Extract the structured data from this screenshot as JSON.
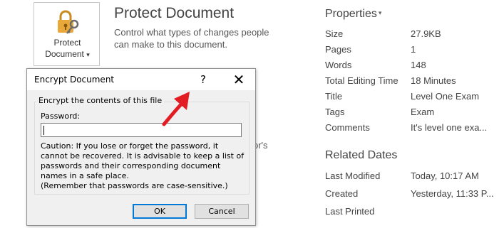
{
  "protect": {
    "tile_line1": "Protect",
    "tile_line2": "Document",
    "tile_caret": "▾",
    "title": "Protect Document",
    "description": "Control what types of changes people can make to this document.",
    "partial_bg_text": "or's"
  },
  "properties": {
    "heading": "Properties",
    "heading_caret": "▾",
    "rows": [
      {
        "label": "Size",
        "value": "27.9KB"
      },
      {
        "label": "Pages",
        "value": "1"
      },
      {
        "label": "Words",
        "value": "148"
      },
      {
        "label": "Total Editing Time",
        "value": "18 Minutes"
      },
      {
        "label": "Title",
        "value": "Level One Exam"
      },
      {
        "label": "Tags",
        "value": "Exam"
      },
      {
        "label": "Comments",
        "value": "It's level one exa..."
      }
    ]
  },
  "related_dates": {
    "heading": "Related Dates",
    "rows": [
      {
        "label": "Last Modified",
        "value": "Today, 10:17 AM"
      },
      {
        "label": "Created",
        "value": "Yesterday, 11:33 P..."
      },
      {
        "label": "Last Printed",
        "value": ""
      }
    ]
  },
  "dialog": {
    "title": "Encrypt Document",
    "help": "?",
    "close": "✕",
    "group_label": "Encrypt the contents of this file",
    "password_label": "Password:",
    "password_value": "",
    "caution_lines": [
      "Caution: If you lose or forget the password, it",
      "cannot be recovered. It is advisable to keep a list of",
      "passwords and their corresponding document",
      "names in a safe place.",
      "(Remember that passwords are case-sensitive.)"
    ],
    "ok_label": "OK",
    "cancel_label": "Cancel"
  },
  "colors": {
    "lock_gold": "#e8a93a",
    "key_gray": "#6b6b6b",
    "annotation_red": "#e31b23",
    "ok_border": "#0078d7"
  },
  "icons": {
    "lock": "lock-key-icon",
    "arrow": "red-arrow-annotation"
  }
}
